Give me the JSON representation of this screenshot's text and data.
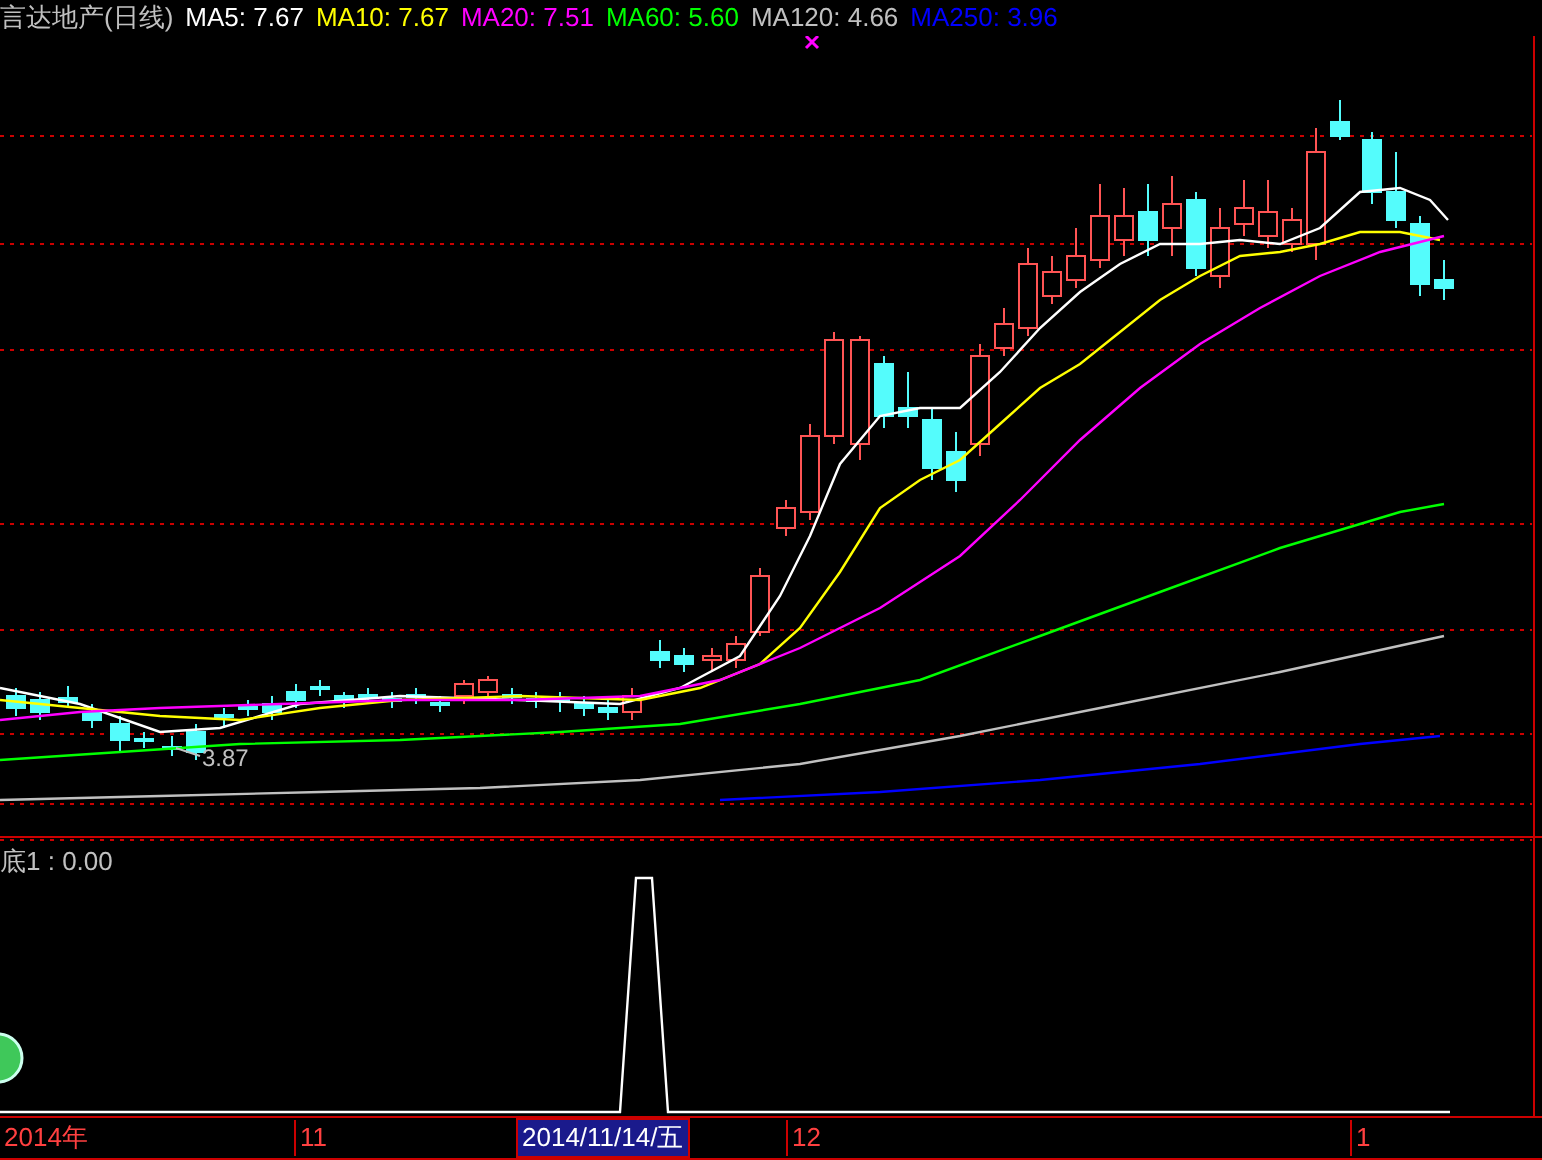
{
  "window": {
    "title": "言达地产(日线)"
  },
  "indicators": [
    {
      "label": "MA5: 7.67",
      "color": "#ffffff"
    },
    {
      "label": "MA10: 7.67",
      "color": "#ffff00"
    },
    {
      "label": "MA20: 7.51",
      "color": "#ff00ff"
    },
    {
      "label": "MA60: 5.60",
      "color": "#00ff00"
    },
    {
      "label": "MA120: 4.66",
      "color": "#c0c0c0"
    },
    {
      "label": "MA250: 3.96",
      "color": "#0000ff"
    }
  ],
  "price_label": "3.87",
  "lower_panel": {
    "label": "底1 : 0.00"
  },
  "time_axis": [
    {
      "label": "2014年",
      "selected": false
    },
    {
      "label": "11",
      "selected": false
    },
    {
      "label": "2014/11/14/五",
      "selected": true
    },
    {
      "label": "12",
      "selected": false
    },
    {
      "label": "1",
      "selected": false
    }
  ]
}
